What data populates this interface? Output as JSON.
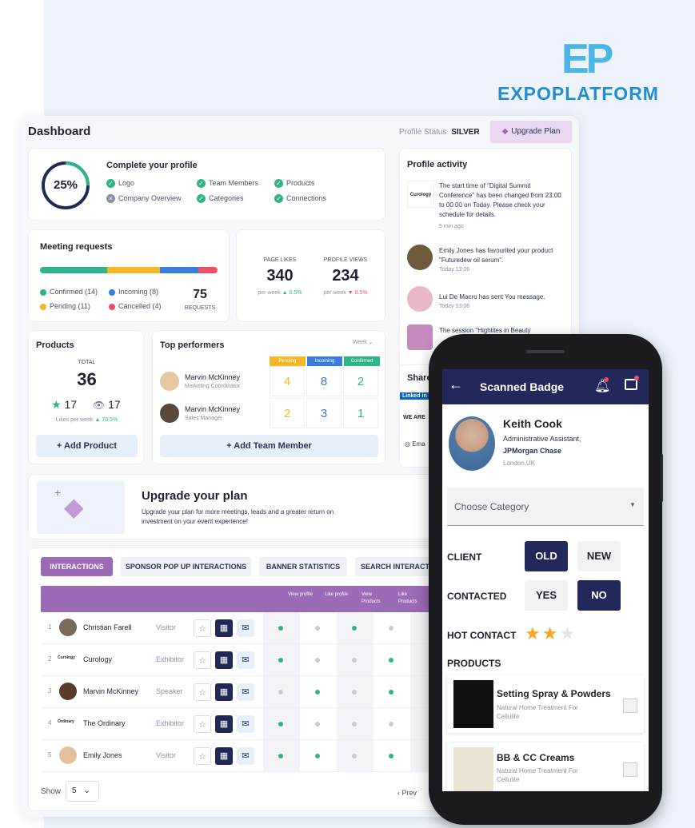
{
  "brand": {
    "logo_mark": "EP",
    "logo_word": "EXPOPLATFORM"
  },
  "dashboard": {
    "title": "Dashboard",
    "profile_status_label": "Profile Status",
    "profile_status_value": "SILVER",
    "upgrade_btn": "Upgrade Plan",
    "complete": {
      "percent": "25%",
      "percent_value": 0.25,
      "title": "Complete your profile",
      "items": [
        {
          "label": "Logo",
          "done": true
        },
        {
          "label": "Team Members",
          "done": true
        },
        {
          "label": "Products",
          "done": true
        },
        {
          "label": "Company Overview",
          "done": false
        },
        {
          "label": "Categories",
          "done": true
        },
        {
          "label": "Connections",
          "done": true
        }
      ]
    },
    "meetings": {
      "title": "Meeting requests",
      "bar": [
        {
          "value": 14,
          "color": "#2fb38a"
        },
        {
          "value": 11,
          "color": "#f5b824"
        },
        {
          "value": 8,
          "color": "#3b7ddd"
        },
        {
          "value": 4,
          "color": "#ec4f66"
        }
      ],
      "confirmed": "Confirmed (14)",
      "incoming": "Incoming (8)",
      "pending": "Pending (11)",
      "cancelled": "Cancelled (4)",
      "total": "75",
      "total_label": "REQUESTS"
    },
    "stats": {
      "page_likes_label": "PAGE LIKES",
      "page_likes": "340",
      "page_likes_sub": "per week",
      "page_likes_delta": "0.5%",
      "profile_views_label": "PROFILE VIEWS",
      "profile_views": "234",
      "profile_views_sub": "per week",
      "profile_views_delta": "0.5%"
    },
    "activity": {
      "title": "Profile activity",
      "items": [
        {
          "logo": "Curology",
          "text": "The start time of \"Digital Summit Conference\" has been changed from 23:00 to 00:00 on Today. Please check your schedule for details.",
          "time": "5 min ago"
        },
        {
          "text": "Emily Jones has favourited your product \"Futuredew oil serum\".",
          "time": "Today 13:06"
        },
        {
          "text": "Lui De Macro has sent You message.",
          "time": "Today 13:06"
        },
        {
          "text": "The session \"Highlites in Beauty",
          "time": ""
        }
      ],
      "share_label": "Share",
      "share_sub": "WE ARE",
      "linkedin": "Linked in",
      "email_label": "Ema"
    },
    "products": {
      "title": "Products",
      "total_label": "TOTAL",
      "total": "36",
      "stars": "17",
      "views": "17",
      "likes_sub": "Likes per week",
      "likes_delta": "70.5%",
      "add_btn": "Add Product"
    },
    "performers": {
      "title": "Top performers",
      "period": "Week",
      "headers": [
        "Pending",
        "Incoming",
        "Confirmed"
      ],
      "header_colors": [
        "#f5b824",
        "#3b7ddd",
        "#2fb38a"
      ],
      "rows": [
        {
          "name": "Marvin McKinney",
          "role": "Marketing Coordinator",
          "values": [
            "4",
            "8",
            "2"
          ]
        },
        {
          "name": "Marvin McKinney",
          "role": "Sales Manager",
          "values": [
            "2",
            "3",
            "1"
          ]
        }
      ],
      "add_btn": "Add Team Member"
    },
    "upgrade_banner": {
      "title": "Upgrade your plan",
      "text": "Upgrade your plan for more meetings, leads and a greater return on investment on your event experience!"
    },
    "tabs": [
      "INTERACTIONS",
      "SPONSOR POP UP INTERACTIONS",
      "BANNER STATISTICS",
      "SEARCH INTERACT"
    ],
    "table": {
      "columns": [
        "View profile",
        "Like profile",
        "View Products",
        "Like Products"
      ],
      "rows": [
        {
          "num": "1",
          "name": "Christian Farell",
          "type": "Visitor",
          "logo": "",
          "dots": [
            1,
            0,
            1,
            0
          ]
        },
        {
          "num": "2",
          "name": "Curology",
          "type": "Exhibitor",
          "logo": "Curology",
          "dots": [
            1,
            0,
            0,
            1
          ]
        },
        {
          "num": "3",
          "name": "Marvin McKinney",
          "type": "Speaker",
          "logo": "",
          "dots": [
            0,
            1,
            0,
            1
          ]
        },
        {
          "num": "4",
          "name": "The Ordinary",
          "type": "Exhibitor",
          "logo": "Ordinary",
          "dots": [
            1,
            0,
            0,
            0
          ]
        },
        {
          "num": "5",
          "name": "Emily Jones",
          "type": "Visitor",
          "logo": "",
          "dots": [
            1,
            1,
            0,
            1
          ]
        }
      ],
      "show_label": "Show",
      "show_value": "5",
      "prev_label": "Prev"
    }
  },
  "phone": {
    "title": "Scanned Badge",
    "person": {
      "name": "Keith Cook",
      "title": "Administrative Assistant,",
      "company": "JPMorgan Chase",
      "location": "London,UK"
    },
    "category_placeholder": "Choose Category",
    "client_label": "CLIENT",
    "client_options": [
      "OLD",
      "NEW"
    ],
    "contacted_label": "CONTACTED",
    "contacted_options": [
      "YES",
      "NO"
    ],
    "hot_label": "HOT CONTACT",
    "hot_rating": 2,
    "hot_max": 3,
    "products_label": "PRODUCTS",
    "products": [
      {
        "name": "Setting Spray & Powders",
        "desc": "Natural Home Treatment For Cellulite"
      },
      {
        "name": "BB & CC Creams",
        "desc": "Natural Home Treatment For Cellulite"
      }
    ]
  }
}
